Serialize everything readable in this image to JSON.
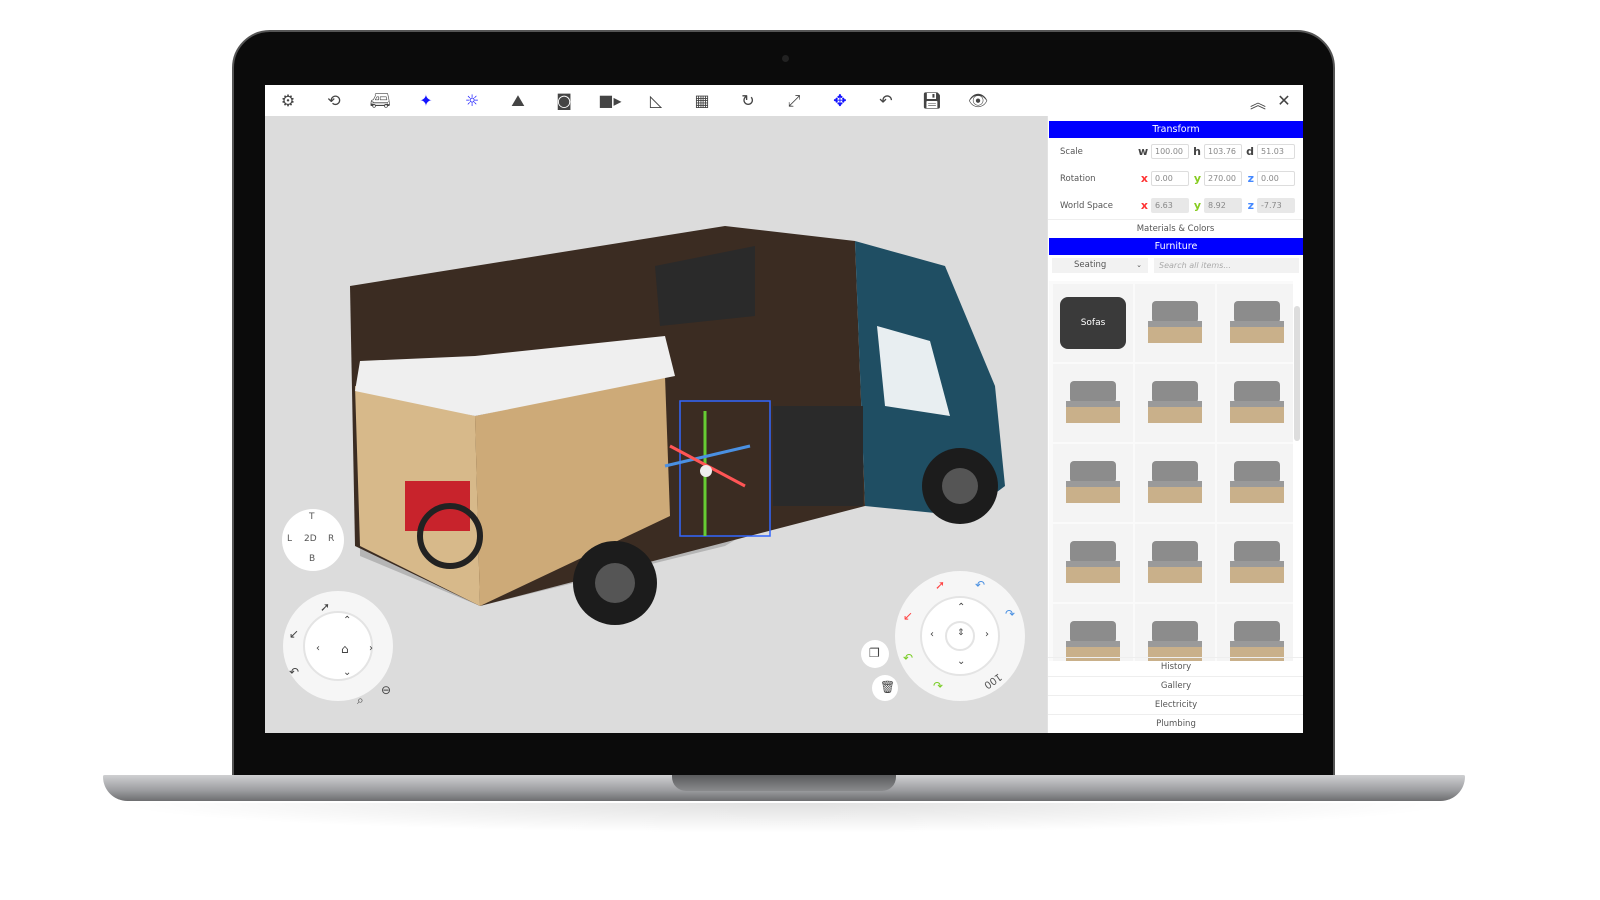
{
  "toolbar": {
    "icons": [
      "gear-icon",
      "rotate-view-icon",
      "van-icon",
      "sparkle-icon",
      "sun-icon",
      "terrain-icon",
      "camera-icon",
      "video-icon",
      "ruler-icon",
      "grid-icon",
      "refresh-icon",
      "resize-icon",
      "move-icon",
      "undo-icon",
      "save-icon",
      "eye-icon"
    ],
    "active_color": "#1414ff",
    "collapse_icon": "chevron-double-up-icon",
    "close_icon": "close-icon"
  },
  "panel": {
    "transform": {
      "title": "Transform",
      "scale": {
        "label": "Scale",
        "w_label": "w",
        "w": "100.00",
        "h_label": "h",
        "h": "103.76",
        "d_label": "d",
        "d": "51.03"
      },
      "rotation": {
        "label": "Rotation",
        "x_label": "x",
        "x": "0.00",
        "y_label": "y",
        "y": "270.00",
        "z_label": "z",
        "z": "0.00"
      },
      "world": {
        "label": "World Space",
        "x_label": "x",
        "x": "6.63",
        "y_label": "y",
        "y": "8.92",
        "z_label": "z",
        "z": "-7.73"
      }
    },
    "materials": "Materials & Colors",
    "furniture": {
      "title": "Furniture",
      "category": "Seating",
      "search_placeholder": "Search all items...",
      "first_tile": "Sofas",
      "item_count": 15
    },
    "sections": [
      "History",
      "Gallery",
      "Electricity",
      "Plumbing"
    ],
    "header_color": "#0000ff"
  },
  "view_cube": {
    "top": "T",
    "left": "L",
    "center": "2D",
    "right": "R",
    "bottom": "B"
  },
  "object_wheel": {
    "step_label": "100"
  }
}
